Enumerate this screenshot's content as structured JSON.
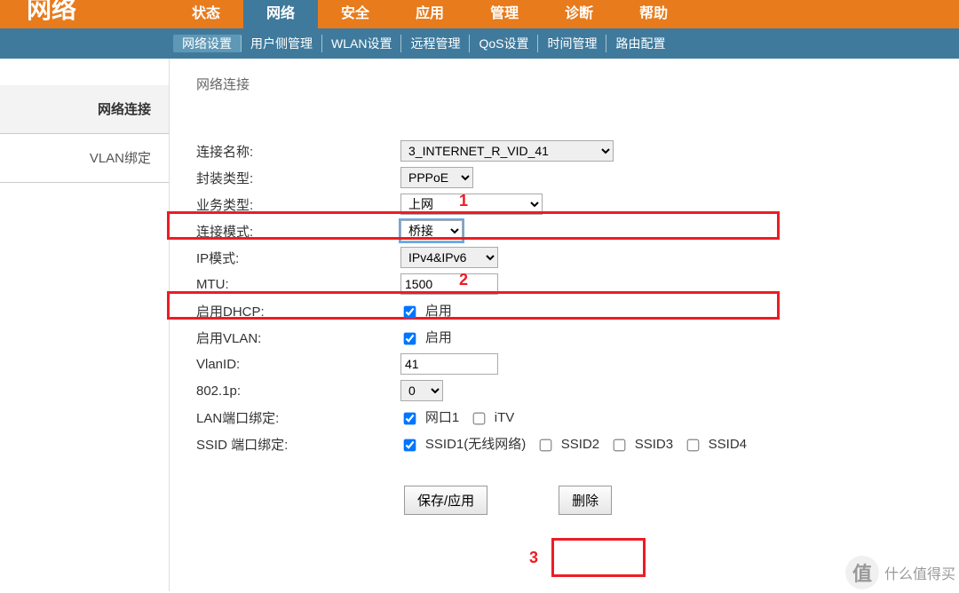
{
  "brand": "网络",
  "topnav": [
    "状态",
    "网络",
    "安全",
    "应用",
    "管理",
    "诊断",
    "帮助"
  ],
  "topnav_active": 1,
  "subnav": [
    "网络设置",
    "用户侧管理",
    "WLAN设置",
    "远程管理",
    "QoS设置",
    "时间管理",
    "路由配置"
  ],
  "subnav_active": 0,
  "sidebar": [
    {
      "label": "网络连接",
      "active": true
    },
    {
      "label": "VLAN绑定",
      "active": false
    }
  ],
  "section_title": "网络连接",
  "annotations": {
    "n1": "1",
    "n2": "2",
    "n3": "3"
  },
  "form": {
    "conn_name": {
      "label": "连接名称:",
      "value": "3_INTERNET_R_VID_41"
    },
    "encap": {
      "label": "封装类型:",
      "value": "PPPoE"
    },
    "svc_type": {
      "label": "业务类型:",
      "value": "上网"
    },
    "conn_mode": {
      "label": "连接模式:",
      "value": "桥接"
    },
    "ip_mode": {
      "label": "IP模式:",
      "value": "IPv4&IPv6"
    },
    "mtu": {
      "label": "MTU:",
      "value": "1500"
    },
    "dhcp": {
      "label": "启用DHCP:",
      "checked": true,
      "text": "启用"
    },
    "vlan": {
      "label": "启用VLAN:",
      "checked": true,
      "text": "启用"
    },
    "vlanid": {
      "label": "VlanID:",
      "value": "41"
    },
    "dot1p": {
      "label": "802.1p:",
      "value": "0"
    },
    "lanbind": {
      "label": "LAN端口绑定:",
      "opt1_checked": true,
      "opt1": "网口1",
      "opt2_checked": false,
      "opt2": "iTV"
    },
    "ssidbind": {
      "label": "SSID 端口绑定:",
      "s1_checked": true,
      "s1": "SSID1(无线网络)",
      "s2": "SSID2",
      "s3": "SSID3",
      "s4": "SSID4"
    }
  },
  "buttons": {
    "save": "保存/应用",
    "del": "删除"
  },
  "watermark": "什么值得买"
}
